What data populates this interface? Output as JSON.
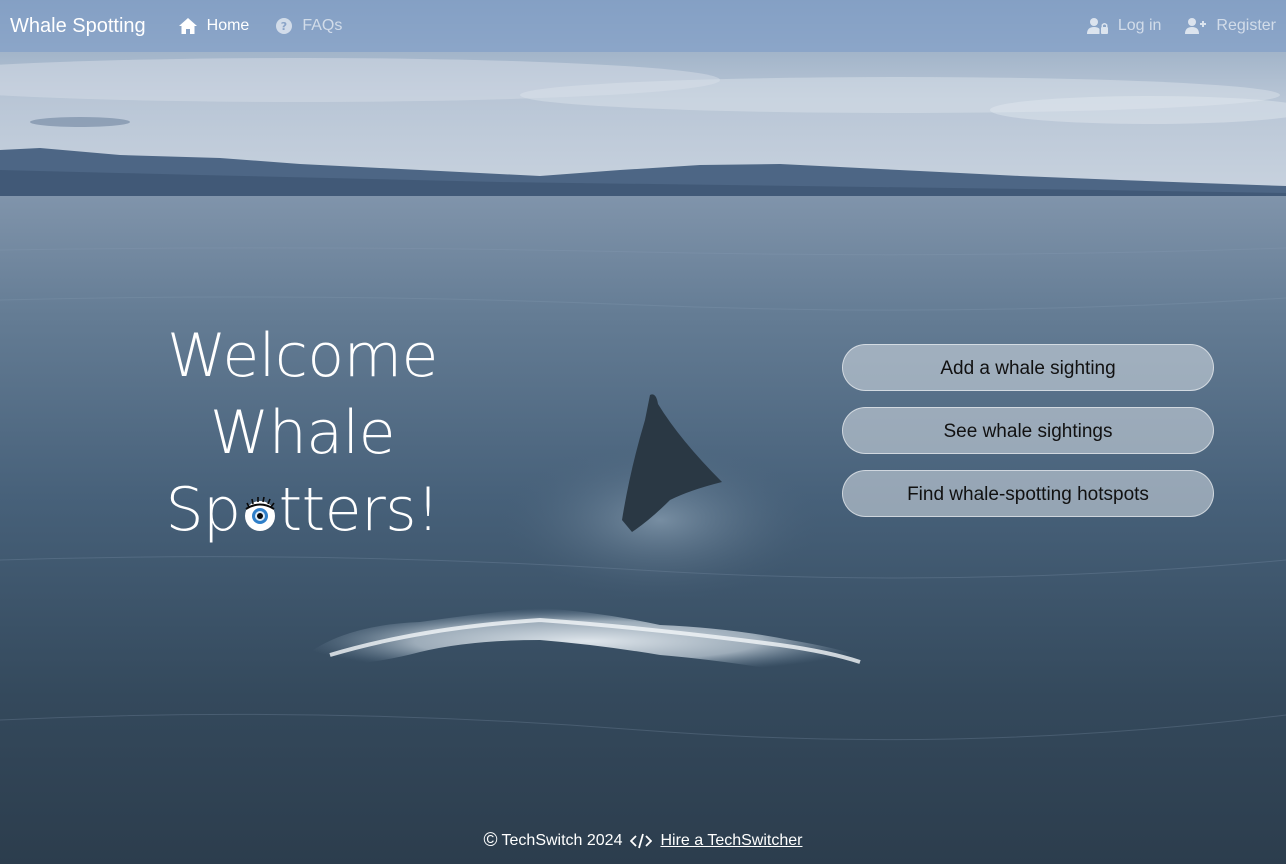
{
  "navbar": {
    "brand": "Whale Spotting",
    "links": [
      {
        "label": "Home",
        "icon": "home-icon",
        "active": true
      },
      {
        "label": "FAQs",
        "icon": "question-circle-icon",
        "active": false
      }
    ],
    "right_links": [
      {
        "label": "Log in",
        "icon": "user-lock-icon"
      },
      {
        "label": "Register",
        "icon": "user-plus-icon"
      }
    ]
  },
  "hero": {
    "line1": "Welcome",
    "line2": "Whale",
    "line3_before": "Sp",
    "line3_after": "tters!",
    "eye_icon": "eye-icon"
  },
  "actions": [
    {
      "label": "Add a whale sighting"
    },
    {
      "label": "See whale sightings"
    },
    {
      "label": "Find whale-spotting hotspots"
    }
  ],
  "footer": {
    "copyright_symbol": "©",
    "copyright": "TechSwitch 2024",
    "code_icon": "code-icon",
    "link": "Hire a TechSwitcher"
  },
  "colors": {
    "navbar_bg": "#82a0c8",
    "sky": "#c3d0de",
    "water_dark": "#2c4355",
    "button_bg": "#d7dee6",
    "eye_iris": "#2f7fc9"
  }
}
